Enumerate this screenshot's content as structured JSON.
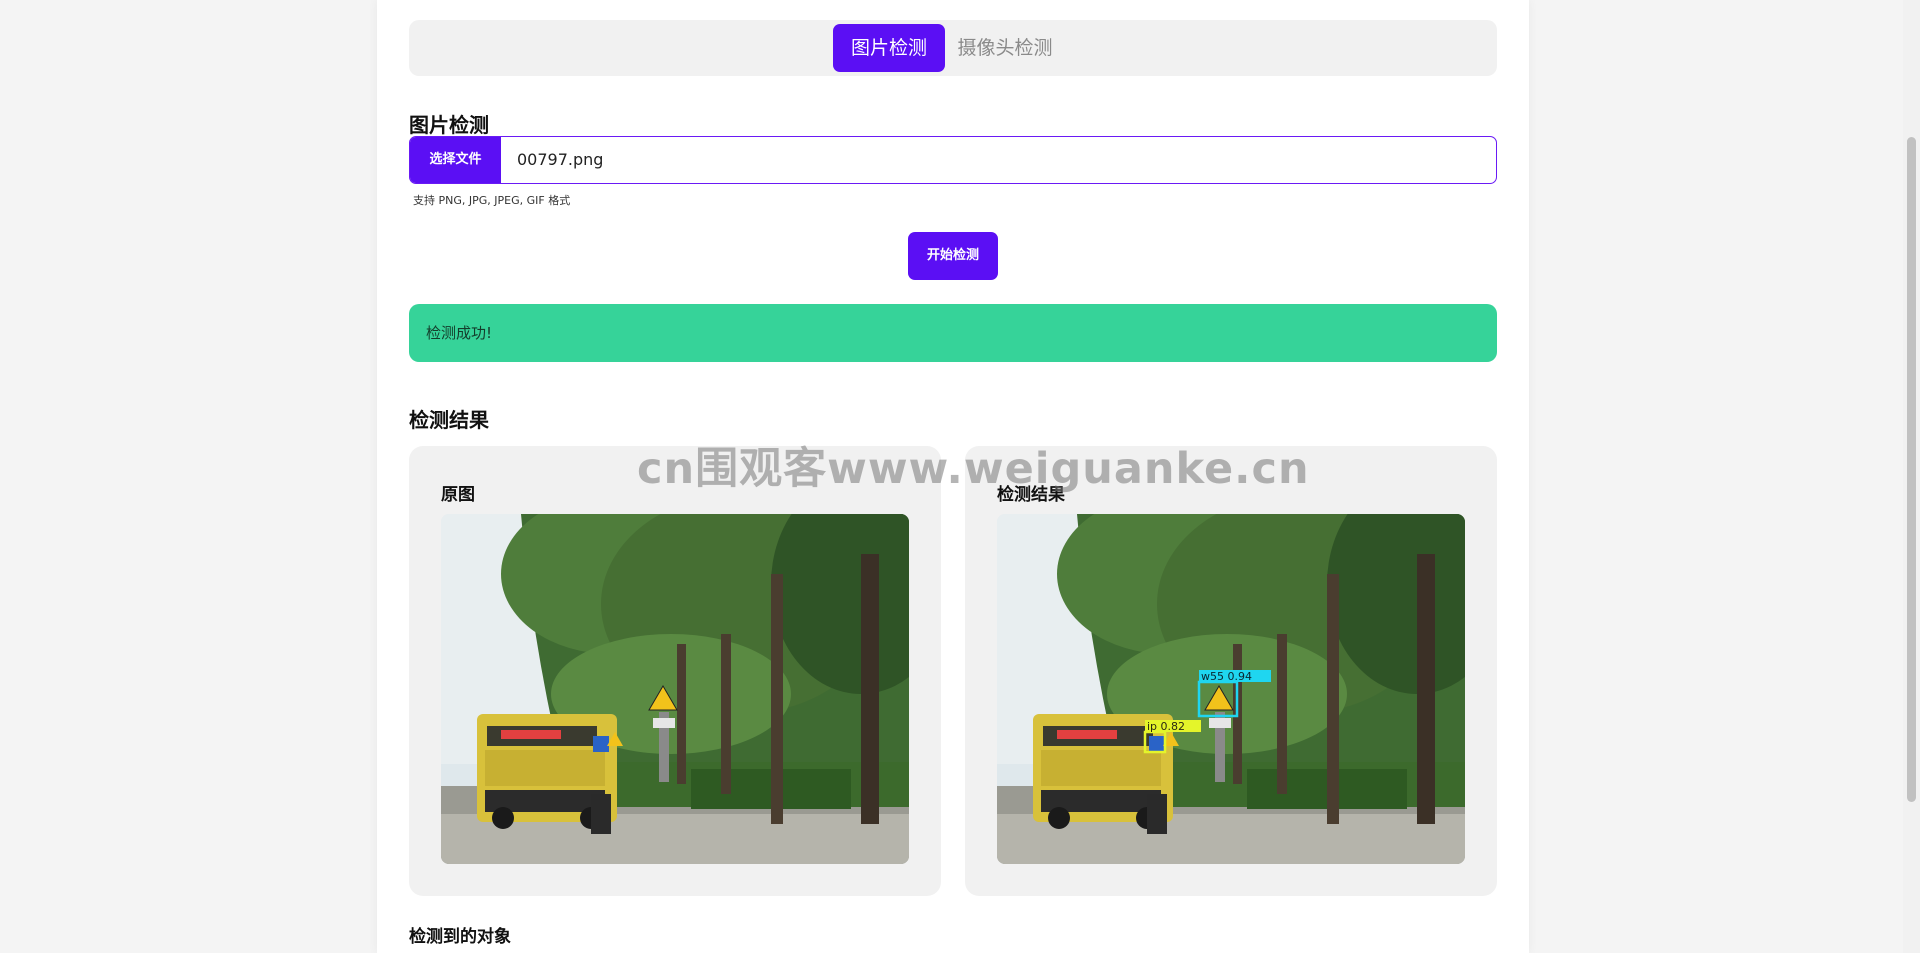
{
  "tabs": [
    {
      "label": "图片检测",
      "active": true
    },
    {
      "label": "摄像头检测",
      "active": false
    }
  ],
  "upload": {
    "section_title": "图片检测",
    "choose_label": "选择文件",
    "file_name": "00797.png",
    "hint": "支持 PNG, JPG, JPEG, GIF 格式",
    "start_label": "开始检测"
  },
  "status": {
    "message": "检测成功!",
    "color": "#36d399"
  },
  "results": {
    "title": "检测结果",
    "original_label": "原图",
    "detected_label": "检测结果",
    "detections": [
      {
        "label": "w55",
        "score": "0.94",
        "color": "#1fd6f0"
      },
      {
        "label": "ip",
        "score": "0.82",
        "color": "#e4f52a"
      }
    ]
  },
  "objects_title": "检测到的对象",
  "watermark": "cn围观客www.weiguanke.cn",
  "theme": {
    "accent": "#5b0ff4"
  }
}
